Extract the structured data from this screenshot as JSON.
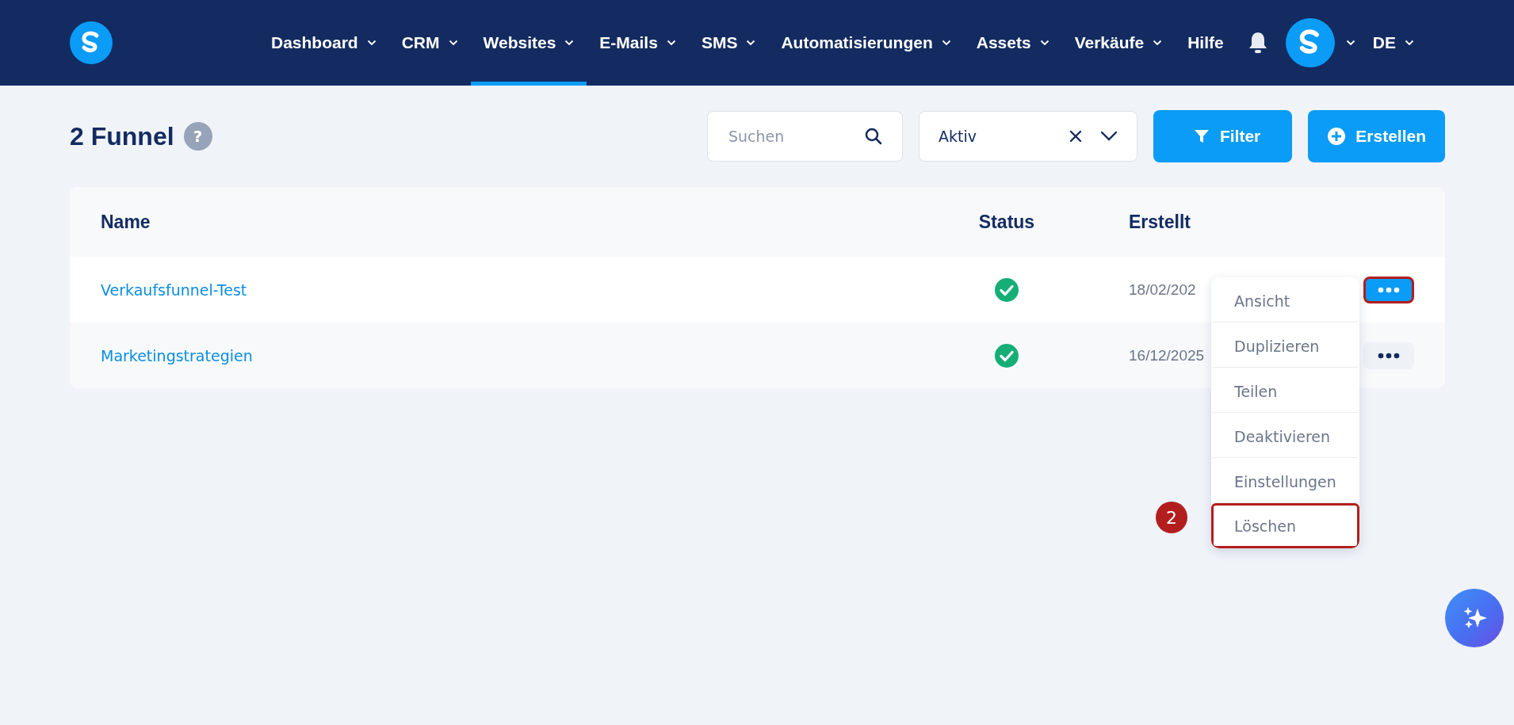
{
  "nav": {
    "items": [
      {
        "label": "Dashboard",
        "dropdown": true,
        "selected": false
      },
      {
        "label": "CRM",
        "dropdown": true,
        "selected": false
      },
      {
        "label": "Websites",
        "dropdown": true,
        "selected": true
      },
      {
        "label": "E-Mails",
        "dropdown": true,
        "selected": false
      },
      {
        "label": "SMS",
        "dropdown": true,
        "selected": false
      },
      {
        "label": "Automatisierungen",
        "dropdown": true,
        "selected": false
      },
      {
        "label": "Assets",
        "dropdown": true,
        "selected": false
      },
      {
        "label": "Verkäufe",
        "dropdown": true,
        "selected": false
      },
      {
        "label": "Hilfe",
        "dropdown": false,
        "selected": false
      }
    ],
    "language": "DE"
  },
  "header": {
    "title": "2 Funnel",
    "help": "?"
  },
  "toolbar": {
    "search": {
      "placeholder": "Suchen"
    },
    "status_filter": {
      "value": "Aktiv"
    },
    "buttons": [
      {
        "label": "Filter",
        "kind": "filter"
      },
      {
        "label": "Erstellen",
        "kind": "create"
      }
    ]
  },
  "table": {
    "columns": [
      "Name",
      "Status",
      "Erstellt"
    ],
    "rows": [
      {
        "name": "Verkaufsfunnel-Test",
        "active": true,
        "created": "18/02/202",
        "menu_open": true,
        "highlighted": true
      },
      {
        "name": "Marketingstrategien",
        "active": true,
        "created": "16/12/2025",
        "menu_open": false,
        "highlighted": false
      }
    ]
  },
  "context_menu": {
    "items": [
      {
        "label": "Ansicht",
        "highlighted": false
      },
      {
        "label": "Duplizieren",
        "highlighted": false
      },
      {
        "label": "Teilen",
        "highlighted": false
      },
      {
        "label": "Deaktivieren",
        "highlighted": false
      },
      {
        "label": "Einstellungen",
        "highlighted": false
      },
      {
        "label": "Löschen",
        "highlighted": true
      }
    ]
  },
  "step_badge": "2"
}
